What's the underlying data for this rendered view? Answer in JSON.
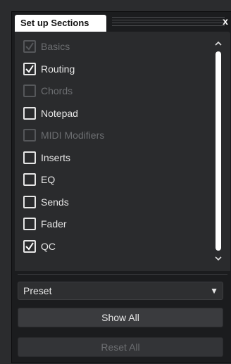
{
  "window": {
    "tab_title": "Set up Sections",
    "close_label": "x"
  },
  "sections": [
    {
      "label": "Basics",
      "checked": true,
      "enabled": false
    },
    {
      "label": "Routing",
      "checked": true,
      "enabled": true
    },
    {
      "label": "Chords",
      "checked": false,
      "enabled": false
    },
    {
      "label": "Notepad",
      "checked": false,
      "enabled": true
    },
    {
      "label": "MIDI Modifiers",
      "checked": false,
      "enabled": false
    },
    {
      "label": "Inserts",
      "checked": false,
      "enabled": true
    },
    {
      "label": "EQ",
      "checked": false,
      "enabled": true
    },
    {
      "label": "Sends",
      "checked": false,
      "enabled": true
    },
    {
      "label": "Fader",
      "checked": false,
      "enabled": true
    },
    {
      "label": "QC",
      "checked": true,
      "enabled": true
    }
  ],
  "preset": {
    "value": "Preset"
  },
  "buttons": {
    "show_all": "Show All",
    "reset_all": "Reset All"
  },
  "icons": {
    "close": "close-icon",
    "dropdown": "triangle-down-icon",
    "scroll_up": "chevron-up-icon",
    "scroll_down": "chevron-down-icon",
    "check": "checkmark-icon"
  },
  "colors": {
    "window_bg": "#1b1c1e",
    "panel_bg": "#2a2b2d",
    "text": "#e6e6e6",
    "text_disabled": "#6c6e71",
    "tab_bg": "#ffffff"
  }
}
